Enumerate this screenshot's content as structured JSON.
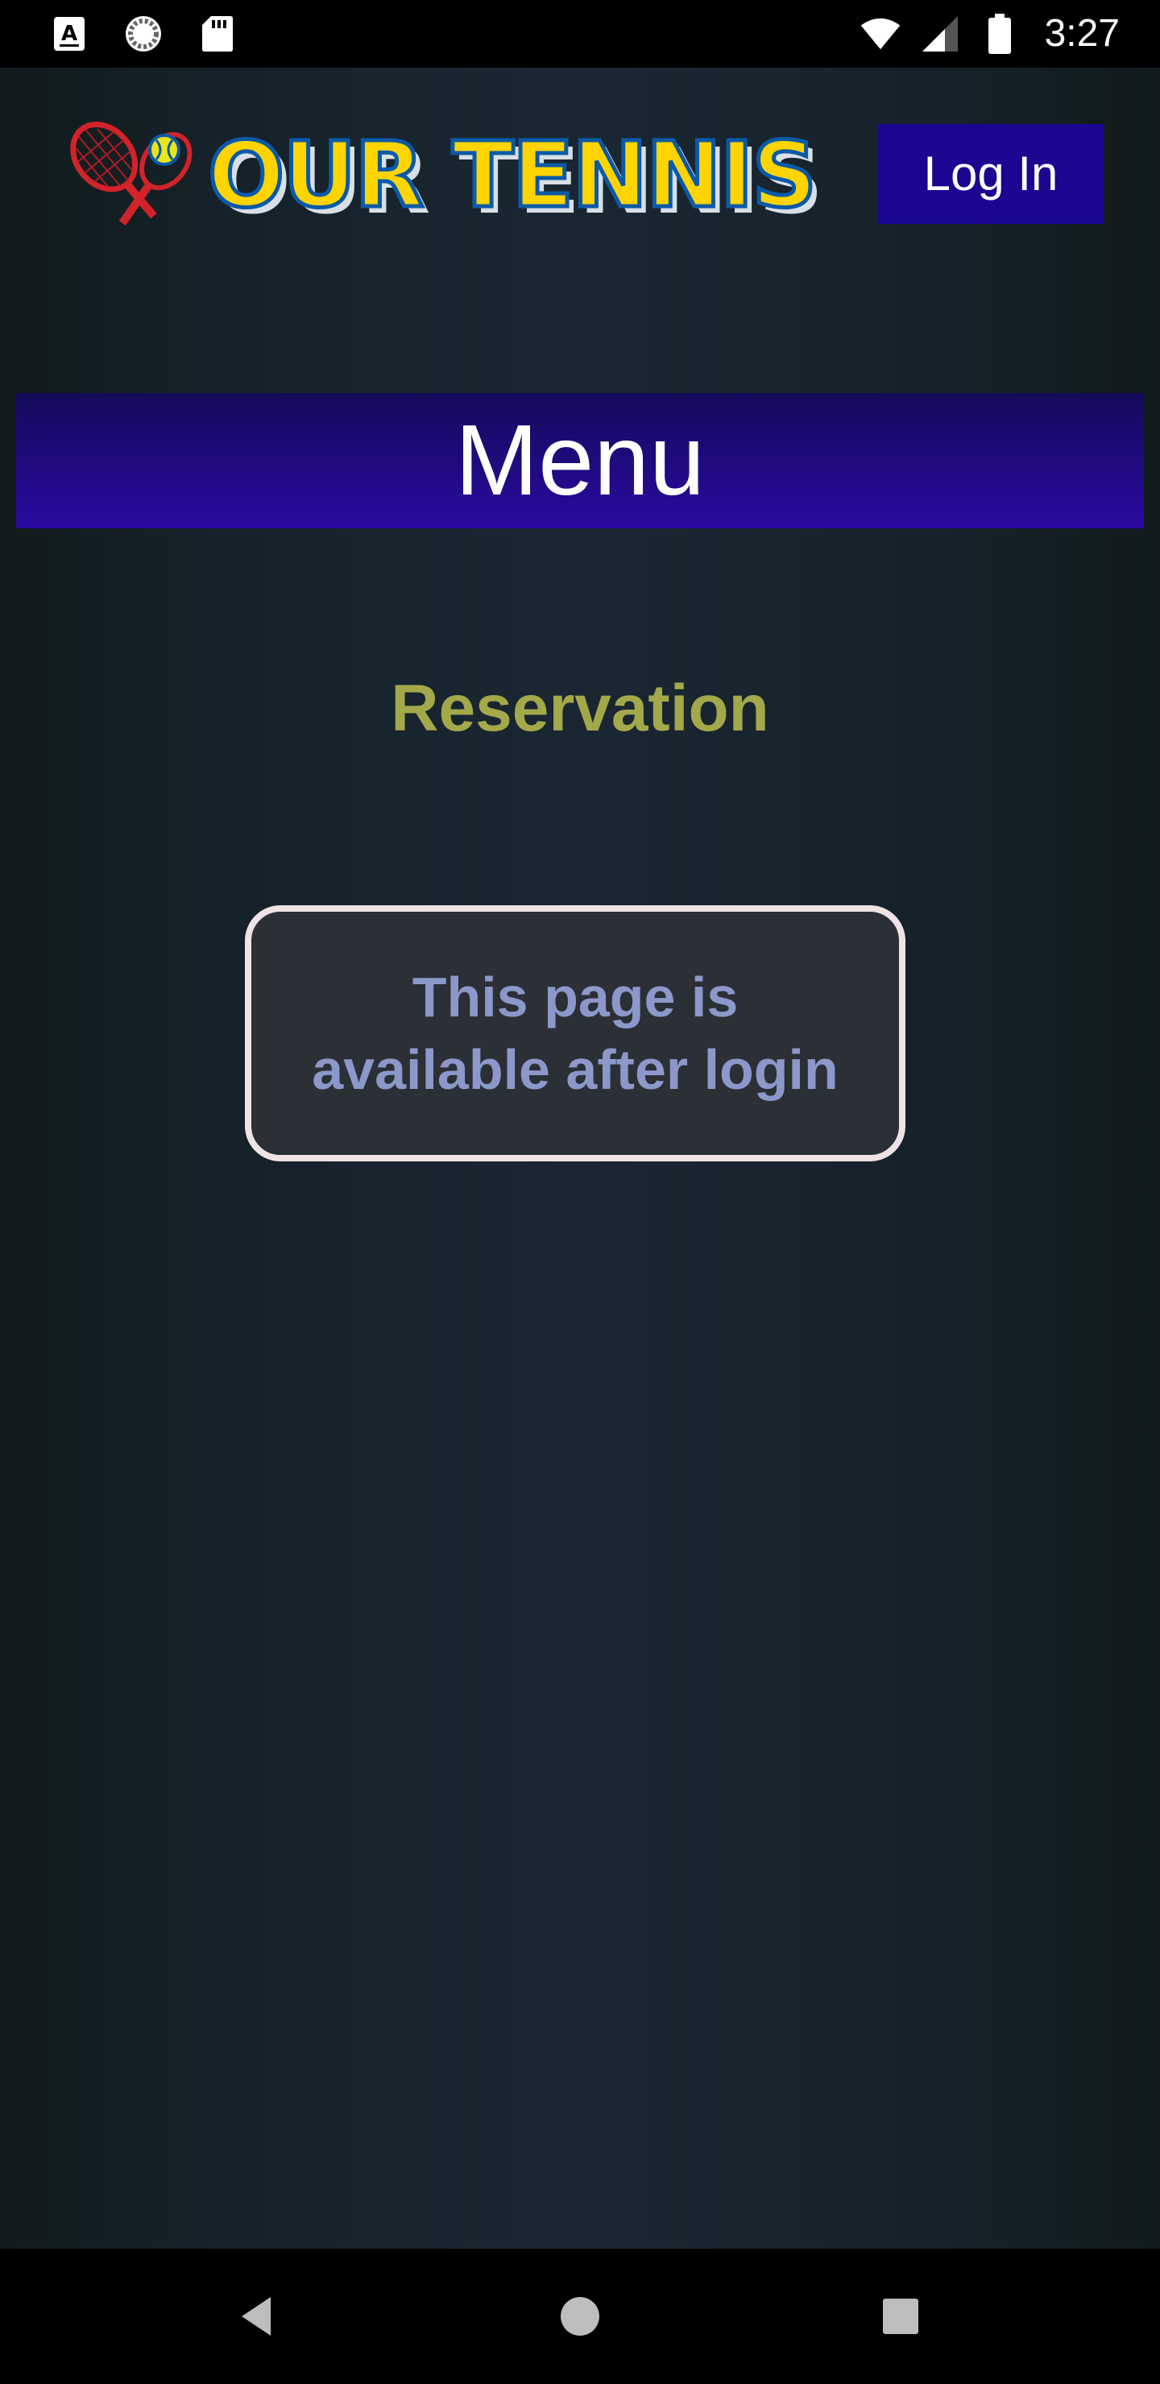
{
  "status_bar": {
    "time": "3:27",
    "icons": [
      "font-a-icon",
      "sync-spinner-icon",
      "sd-card-icon",
      "wifi-icon",
      "signal-icon",
      "battery-icon"
    ]
  },
  "header": {
    "logo_text": "OUR TENNIS",
    "login_label": "Log In"
  },
  "menu": {
    "title": "Menu"
  },
  "reservation": {
    "title": "Reservation"
  },
  "notice": {
    "line1": "This page is",
    "line2": "available after login"
  },
  "nav_bar": {
    "icons": [
      "back-icon",
      "home-icon",
      "recents-icon"
    ]
  },
  "colors": {
    "login_button": "#1a0690",
    "menu_banner_top": "#140a5a",
    "menu_banner_bottom": "#2a0aa0",
    "reservation_text": "#a3a84a",
    "notice_text": "#8c98c9",
    "notice_border": "#efe3e6",
    "notice_bg": "#2b2f36",
    "logo_yellow": "#ffd400",
    "logo_blue": "#0b5aa8"
  }
}
